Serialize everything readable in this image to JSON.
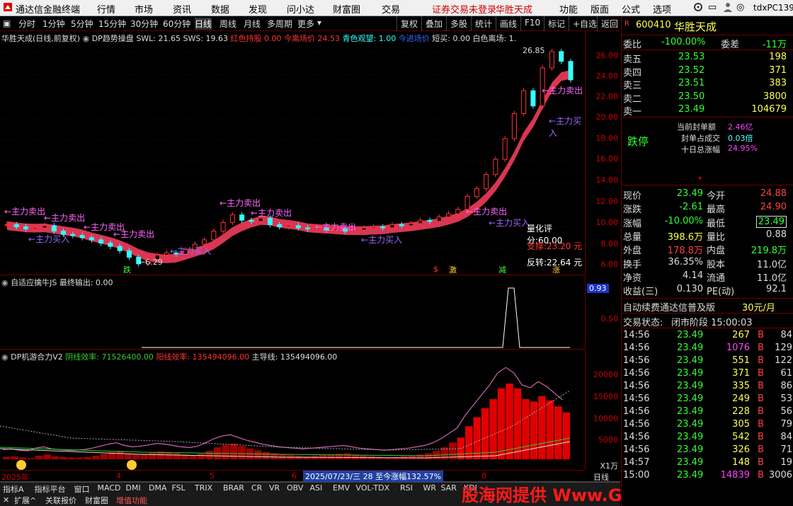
{
  "menu": {
    "app_title": "通达信金融终端",
    "items": [
      "行情",
      "市场",
      "资讯",
      "数据",
      "发现",
      "问小达",
      "财富圈",
      "交易"
    ],
    "login_notice": "证券交易未登录",
    "stock_name": "华胜天成",
    "right_items": [
      "功能",
      "版面",
      "公式",
      "选项"
    ],
    "user": "tdxPC139"
  },
  "period_bar": {
    "periods": [
      "分时",
      "1分钟",
      "5分钟",
      "15分钟",
      "30分钟",
      "60分钟",
      "日线",
      "周线",
      "月线",
      "多周期",
      "更多"
    ],
    "selected": "日线",
    "tools": [
      "复权",
      "叠加",
      "多股",
      "统计",
      "画线",
      "F10",
      "标记",
      "+自选",
      "返回"
    ]
  },
  "main_pane": {
    "title": "华胜天成(日线,前复权)",
    "ind_name": "DP趋势操盘",
    "swl": "SWL: 21.65",
    "sws": "SWS: 19.63",
    "red_hold_label": "红色持股",
    "red_hold_val": "0.00",
    "today_exit_label": "今离场价",
    "today_exit_val": "24.53",
    "cyan_watch": "青色观望: 1.00",
    "today_entry": "今进场价",
    "short_buy": "短买: 0.00",
    "white_exit": "白色离场: 1.",
    "annotations": {
      "sell": "主力卖出",
      "buy": "主力买入",
      "high": "26.85",
      "low": "6.29",
      "score": "量化评分:60.00",
      "support": "支撑:23.20 元",
      "reversal": "反转:22.64 元",
      "die": "跌",
      "ji": "激",
      "jian": "减",
      "zhang": "涨",
      "dollar": "$"
    },
    "y_ticks": [
      "26.00",
      "24.00",
      "22.00",
      "20.00",
      "18.00",
      "16.00",
      "14.00",
      "12.00",
      "10.00",
      "8.00",
      "6.00"
    ]
  },
  "pane2": {
    "title": "自适应擒牛JS",
    "output": "最终输出: 0.00",
    "y_ticks": [
      "0.93",
      "0.50"
    ]
  },
  "pane3": {
    "title": "DP机游合力V2",
    "yin_label": "阴线效率: 71526400.00",
    "yang_label": "阳线效率: 135494096.00",
    "main_label": "主导线: 135494096.00",
    "y_ticks": [
      "20000",
      "15000",
      "10000",
      "5000"
    ],
    "unit": "X1万"
  },
  "x_axis": {
    "year": "2025年",
    "months": [
      "4",
      "5",
      "6",
      "8"
    ],
    "range_info": "2025/07/23/三 28 至今涨幅132.57%",
    "period_label": "日线"
  },
  "indicator_tabs": [
    "指标A",
    "指标平台",
    "窗口",
    "MACD",
    "DMI",
    "DMA",
    "FSL",
    "TRIX",
    "BRAR",
    "CR",
    "VR",
    "OBV",
    "ASI",
    "EMV",
    "VOL-TDX",
    "RSI",
    "WR",
    "SAR",
    "KDJ"
  ],
  "bottom_tabs": [
    "扩展^",
    "关联报价",
    "财富圈",
    "增值功能"
  ],
  "watermark": "股海网提供 Www.Guhai.Com.CN",
  "quote": {
    "code": "600410",
    "name": "华胜天成",
    "weibi_label": "委比",
    "weibi": "-100.00%",
    "weicha_label": "委差",
    "weicha": "-11万",
    "asks": [
      {
        "label": "卖五",
        "price": "23.53",
        "vol": "198"
      },
      {
        "label": "卖四",
        "price": "23.52",
        "vol": "371"
      },
      {
        "label": "卖三",
        "price": "23.51",
        "vol": "383"
      },
      {
        "label": "卖二",
        "price": "23.50",
        "vol": "3800"
      },
      {
        "label": "卖一",
        "price": "23.49",
        "vol": "104679"
      }
    ],
    "limit_status": "跌停",
    "limit_info": [
      {
        "label": "当前封单额",
        "val": "2.46亿"
      },
      {
        "label": "封单占成交",
        "val": "0.03倍"
      },
      {
        "label": "十日总涨幅",
        "val": "24.95%"
      }
    ],
    "stats": [
      {
        "l1": "现价",
        "v1": "23.49",
        "l2": "今开",
        "v2": "24.88"
      },
      {
        "l1": "涨跌",
        "v1": "-2.61",
        "l2": "最高",
        "v2": "24.90"
      },
      {
        "l1": "涨幅",
        "v1": "-10.00%",
        "l2": "最低",
        "v2": "23.49"
      },
      {
        "l1": "总量",
        "v1": "398.6万",
        "l2": "量比",
        "v2": "0.88"
      },
      {
        "l1": "外盘",
        "v1": "178.8万",
        "l2": "内盘",
        "v2": "219.8万"
      },
      {
        "l1": "换手",
        "v1": "36.35%",
        "l2": "股本",
        "v2": "11.0亿"
      },
      {
        "l1": "净资",
        "v1": "4.14",
        "l2": "流通",
        "v2": "11.0亿"
      },
      {
        "l1": "收益(三)",
        "v1": "0.130",
        "l2": "PE(动)",
        "v2": "92.1"
      }
    ],
    "promo": "自动续费通达信普及版",
    "promo_price": "30元/月",
    "trade_state_label": "交易状态:",
    "trade_state": "闭市阶段 15:00:03",
    "ticks": [
      {
        "t": "14:56",
        "p": "23.49",
        "v": "267",
        "s": "B",
        "n": "84"
      },
      {
        "t": "14:56",
        "p": "23.49",
        "v": "1076",
        "s": "B",
        "n": "129"
      },
      {
        "t": "14:56",
        "p": "23.49",
        "v": "551",
        "s": "B",
        "n": "122"
      },
      {
        "t": "14:56",
        "p": "23.49",
        "v": "371",
        "s": "B",
        "n": "61"
      },
      {
        "t": "14:56",
        "p": "23.49",
        "v": "335",
        "s": "B",
        "n": "86"
      },
      {
        "t": "14:56",
        "p": "23.49",
        "v": "249",
        "s": "B",
        "n": "53"
      },
      {
        "t": "14:56",
        "p": "23.49",
        "v": "228",
        "s": "B",
        "n": "56"
      },
      {
        "t": "14:56",
        "p": "23.49",
        "v": "305",
        "s": "B",
        "n": "79"
      },
      {
        "t": "14:56",
        "p": "23.49",
        "v": "542",
        "s": "B",
        "n": "84"
      },
      {
        "t": "14:56",
        "p": "23.49",
        "v": "326",
        "s": "B",
        "n": "71"
      },
      {
        "t": "14:57",
        "p": "23.49",
        "v": "148",
        "s": "B",
        "n": "19"
      },
      {
        "t": "15:00",
        "p": "23.49",
        "v": "14839",
        "s": "B",
        "n": "3006"
      }
    ]
  },
  "chart_data": {
    "type": "candlestick",
    "title": "华胜天成(日线,前复权)",
    "ylim": [
      6.0,
      27.0
    ],
    "series": [
      {
        "name": "close",
        "values": [
          10.2,
          10.0,
          9.8,
          9.9,
          10.1,
          9.6,
          9.3,
          9.2,
          9.0,
          8.8,
          8.5,
          8.2,
          7.8,
          7.2,
          6.6,
          7.0,
          7.4,
          7.6,
          7.5,
          7.9,
          8.4,
          8.8,
          9.6,
          10.4,
          11.1,
          10.6,
          10.5,
          10.8,
          10.2,
          10.0,
          10.1,
          9.9,
          9.8,
          9.9,
          9.7,
          9.8,
          9.6,
          9.7,
          9.9,
          10.0,
          9.9,
          10.2,
          10.1,
          10.3,
          10.6,
          10.5,
          10.9,
          11.2,
          11.6,
          12.8,
          13.5,
          14.8,
          16.2,
          18.1,
          20.4,
          22.5,
          21.1,
          24.6,
          26.1,
          25.2,
          23.5
        ]
      }
    ]
  }
}
